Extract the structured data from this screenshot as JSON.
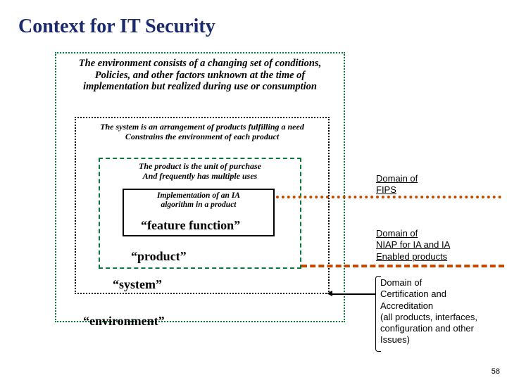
{
  "title": "Context for IT Security",
  "page_number": "58",
  "captions": {
    "environment": "The environment consists of a changing set of conditions,\nPolicies, and other factors unknown at the time of\nimplementation but realized during use or consumption",
    "system": "The system is an arrangement of products fulfilling a need\nConstrains the environment of each product",
    "product": "The product is the unit of purchase\nAnd frequently has multiple uses",
    "feature": "Implementation of an IA\nalgorithm in a product"
  },
  "labels": {
    "feature": "“feature function”",
    "product": "“product”",
    "system": "“system”",
    "environment": "“environment”"
  },
  "domains": {
    "fips": "Domain of\nFIPS",
    "niap": "Domain of\nNIAP for IA and IA\nEnabled products",
    "cert": "Domain of\nCertification and\nAccreditation\n(all products, interfaces,\nconfiguration and other\nIssues)"
  },
  "colors": {
    "title": "#1a2a6c",
    "green": "#0a7a3a",
    "orange": "#c24a00"
  }
}
